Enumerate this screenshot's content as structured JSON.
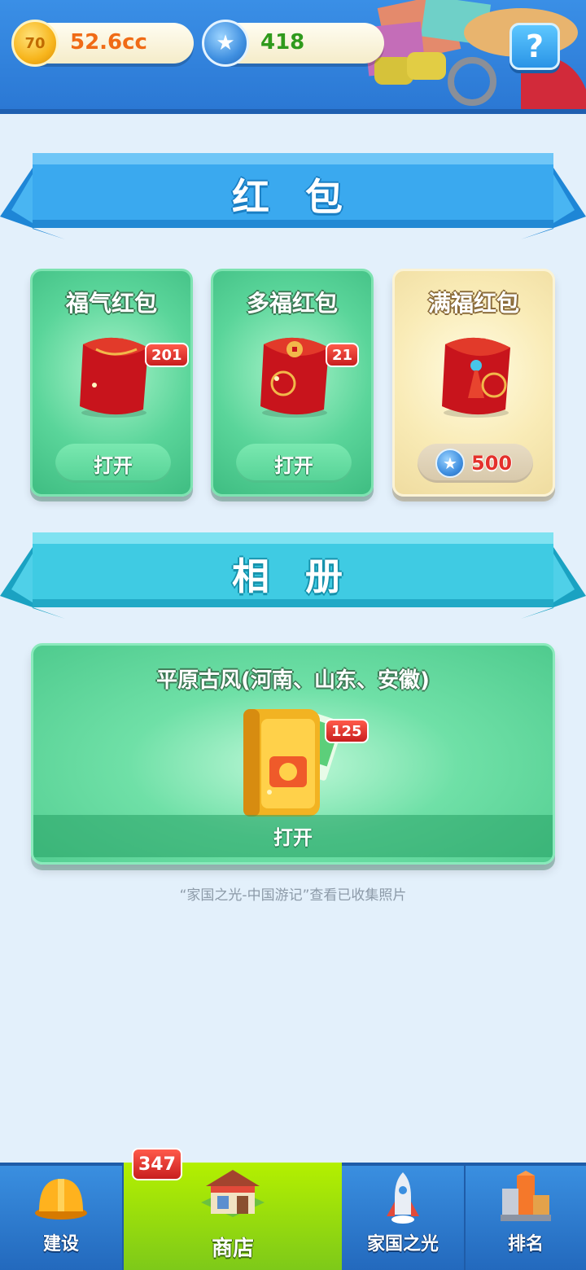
{
  "header": {
    "coins": {
      "value": "52.6cc",
      "icon_label": "70"
    },
    "stars": {
      "value": "418",
      "icon": "star-icon"
    },
    "help": {
      "label": "?"
    }
  },
  "red_packets": {
    "title": "红 包",
    "items": [
      {
        "name": "福气红包",
        "count": "201",
        "button": "打开",
        "style": "green"
      },
      {
        "name": "多福红包",
        "count": "21",
        "button": "打开",
        "style": "green"
      },
      {
        "name": "满福红包",
        "price": "500",
        "style": "gold"
      }
    ]
  },
  "album": {
    "title": "相 册",
    "card_title": "平原古风(河南、山东、安徽)",
    "count": "125",
    "button": "打开",
    "hint": "“家国之光-中国游记”查看已收集照片"
  },
  "nav": {
    "items": [
      {
        "label": "建设",
        "icon": "hardhat-icon"
      },
      {
        "label": "商店",
        "icon": "shop-icon",
        "badge": "347",
        "active": true
      },
      {
        "label": "家国之光",
        "icon": "rocket-icon"
      },
      {
        "label": "排名",
        "icon": "ranking-icon"
      }
    ]
  },
  "colors": {
    "accent_blue": "#2b78d4",
    "card_green": "#5ad59a",
    "card_gold": "#f9ebb6",
    "badge_red": "#c81e1e",
    "nav_active": "#7cc81a"
  }
}
